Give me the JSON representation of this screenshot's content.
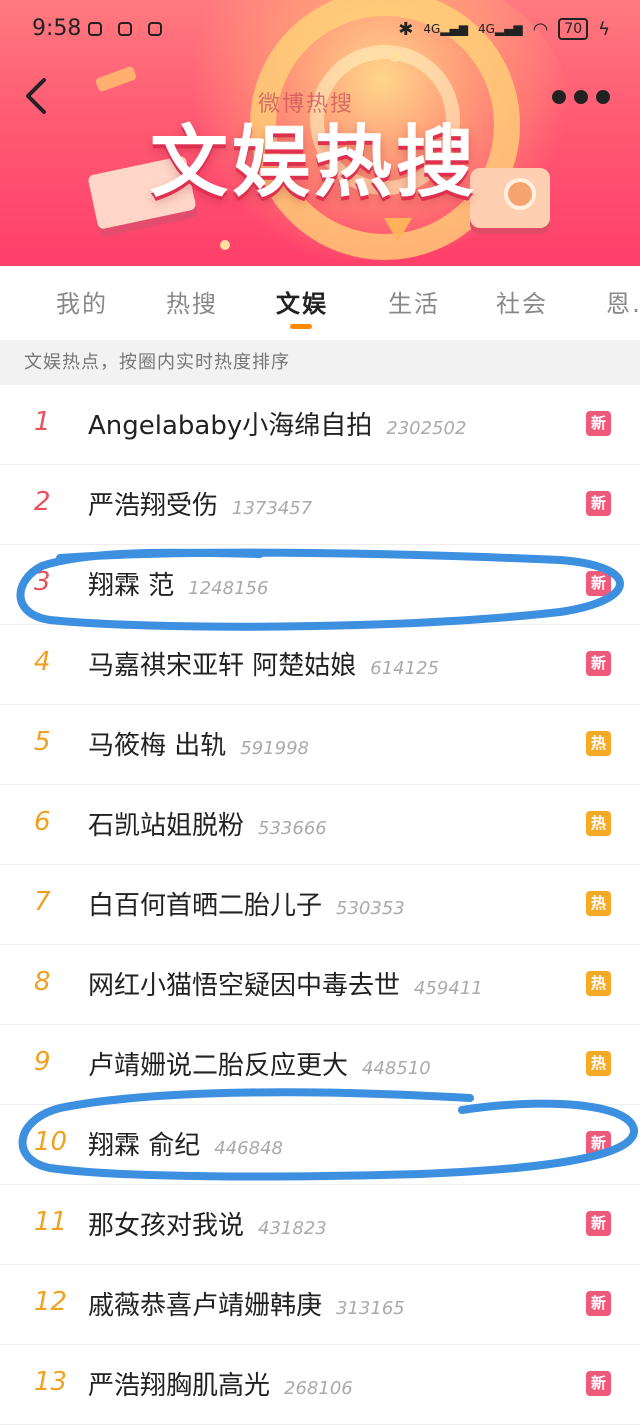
{
  "status_bar": {
    "time": "9:58",
    "network_1": "4G",
    "network_2": "4G",
    "battery": "70"
  },
  "header": {
    "subtitle": "微博热搜",
    "title": "文娱热搜"
  },
  "tabs": [
    {
      "label": "我的",
      "active": false
    },
    {
      "label": "热搜",
      "active": false
    },
    {
      "label": "文娱",
      "active": true
    },
    {
      "label": "生活",
      "active": false
    },
    {
      "label": "社会",
      "active": false
    },
    {
      "label": "恩…",
      "active": false
    }
  ],
  "note": "文娱热点，按圈内实时热度排序",
  "colors": {
    "accent": "#ff8a00",
    "rank_top": "#e8505b",
    "rank_other": "#f0a020",
    "badge_new": "#ef5a7a",
    "badge_hot": "#f7a928",
    "annotation": "#3d8fe0"
  },
  "items": [
    {
      "rank": "1",
      "title": "Angelababy小海绵自拍",
      "count": "2302502",
      "badge": "新"
    },
    {
      "rank": "2",
      "title": "严浩翔受伤",
      "count": "1373457",
      "badge": "新"
    },
    {
      "rank": "3",
      "title": "翔霖 范",
      "count": "1248156",
      "badge": "新"
    },
    {
      "rank": "4",
      "title": "马嘉祺宋亚轩 阿楚姑娘",
      "count": "614125",
      "badge": "新"
    },
    {
      "rank": "5",
      "title": "马筱梅 出轨",
      "count": "591998",
      "badge": "热"
    },
    {
      "rank": "6",
      "title": "石凯站姐脱粉",
      "count": "533666",
      "badge": "热"
    },
    {
      "rank": "7",
      "title": "白百何首晒二胎儿子",
      "count": "530353",
      "badge": "热"
    },
    {
      "rank": "8",
      "title": "网红小猫悟空疑因中毒去世",
      "count": "459411",
      "badge": "热"
    },
    {
      "rank": "9",
      "title": "卢靖姗说二胎反应更大",
      "count": "448510",
      "badge": "热"
    },
    {
      "rank": "10",
      "title": "翔霖 俞纪",
      "count": "446848",
      "badge": "新"
    },
    {
      "rank": "11",
      "title": "那女孩对我说",
      "count": "431823",
      "badge": "新"
    },
    {
      "rank": "12",
      "title": "戚薇恭喜卢靖姗韩庚",
      "count": "313165",
      "badge": "新"
    },
    {
      "rank": "13",
      "title": "严浩翔胸肌高光",
      "count": "268106",
      "badge": "新"
    }
  ]
}
